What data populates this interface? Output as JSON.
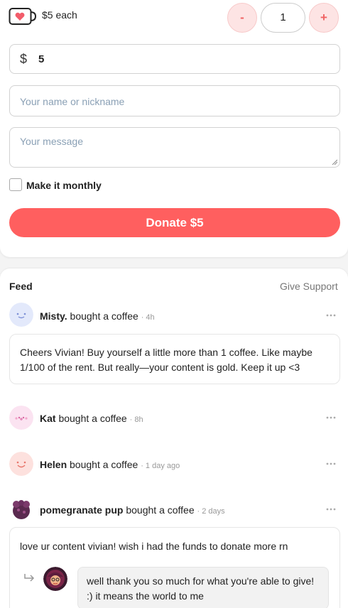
{
  "support": {
    "price_label": "$5 each",
    "quantity": {
      "minus_label": "-",
      "value": "1",
      "plus_label": "+"
    },
    "amount": {
      "currency_symbol": "$",
      "value": "5"
    },
    "name_placeholder": "Your name or nickname",
    "message_placeholder": "Your message",
    "monthly_label": "Make it monthly",
    "donate_label": "Donate $5"
  },
  "feed": {
    "title": "Feed",
    "give_support_label": "Give Support",
    "items": [
      {
        "name": "Misty.",
        "action": " bought a coffee",
        "time": "· 4h",
        "avatar_icon": "smiley-face-blue",
        "message": "Cheers Vivian! Buy yourself a little more than 1 coffee. Like maybe 1/100 of the rent. But really—your content is gold. Keep it up <3"
      },
      {
        "name": "Kat",
        "action": " bought a coffee",
        "time": "· 8h",
        "avatar_icon": "blushing-face-pink"
      },
      {
        "name": "Helen",
        "action": " bought a coffee",
        "time": "· 1 day ago",
        "avatar_icon": "smiley-face-peach"
      },
      {
        "name": "pomegranate pup",
        "action": " bought a coffee",
        "time": "· 2 days",
        "avatar_icon": "pomegranate-avatar",
        "message": "love ur content vivian! wish i had the funds to donate more rn",
        "reply": {
          "avatar_icon": "creator-avatar",
          "text": "well thank you so much for what you're able to give! :) it means the world to me"
        }
      }
    ]
  },
  "colors": {
    "accent": "#ff5f5f",
    "accent_light": "#fde4e4",
    "placeholder": "#8aa0b5",
    "muted": "#777777"
  }
}
